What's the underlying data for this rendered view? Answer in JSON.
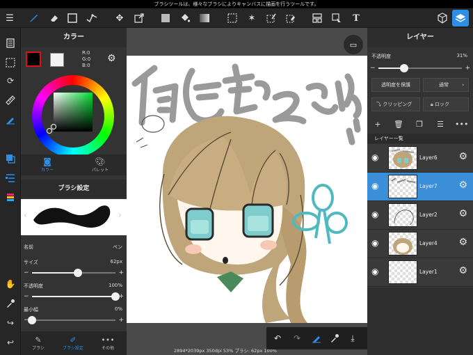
{
  "status_message": "ブラシツールは、様々なブラシによりキャンバスに描画を行うツールです。",
  "color_panel": {
    "title": "カラー",
    "rgb": {
      "r": "R:0",
      "g": "G:0",
      "b": "B:0"
    },
    "tabs": [
      "カラー",
      "パレット"
    ]
  },
  "brush_settings": {
    "title": "ブラシ設定",
    "name_label": "名前",
    "name_value": "ペン",
    "size_label": "サイズ",
    "size_value": "62px",
    "size_fraction": 0.55,
    "opacity_label": "不透明度",
    "opacity_value": "100%",
    "opacity_fraction": 1.0,
    "minwidth_label": "最小幅",
    "minwidth_value": "0%",
    "minwidth_fraction": 0.0
  },
  "bottom_tabs": [
    "ブラシ",
    "ブラシ設定",
    "その他"
  ],
  "canvas": {
    "info": "2894*2039px 350dpi 53% ブラシ: 62px 100%"
  },
  "layer_panel": {
    "title": "レイヤー",
    "opacity_label": "不透明度",
    "opacity_value": "31%",
    "opacity_fraction": 0.31,
    "protect_label": "透明度を保護",
    "blend_label": "通常",
    "clipping_label": "クリッピング",
    "lock_label": "ロック",
    "list_title": "レイヤー一覧",
    "layers": [
      {
        "name": "Layer6",
        "selected": false
      },
      {
        "name": "Layer7",
        "selected": true
      },
      {
        "name": "Layer2",
        "selected": false
      },
      {
        "name": "Layer4",
        "selected": false
      },
      {
        "name": "Layer1",
        "selected": false
      }
    ]
  },
  "colors": {
    "accent": "#2f8fe6",
    "panel": "#333333",
    "toolbar": "#262626"
  }
}
